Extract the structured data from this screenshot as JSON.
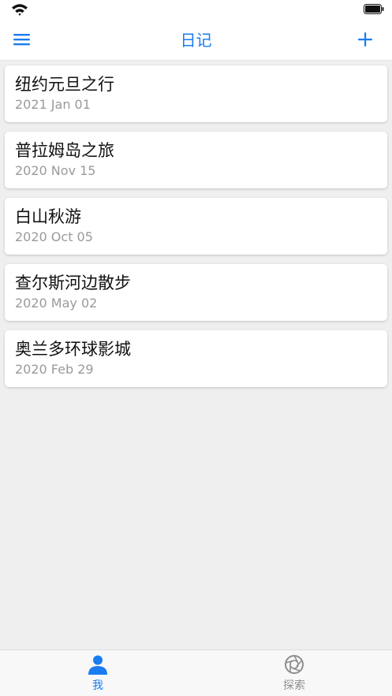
{
  "colors": {
    "accent": "#1a7cf0",
    "background": "#efefef",
    "card": "#ffffff",
    "date_text": "#9a9a9a",
    "inactive_tab": "#8e8e8e"
  },
  "status_bar": {
    "icons": [
      "wifi-icon",
      "battery-icon"
    ]
  },
  "nav": {
    "title": "日记",
    "left_icon": "menu-icon",
    "right_icon": "plus-icon"
  },
  "entries": [
    {
      "title": "纽约元旦之行",
      "date": "2021 Jan 01"
    },
    {
      "title": "普拉姆岛之旅",
      "date": "2020 Nov 15"
    },
    {
      "title": "白山秋游",
      "date": "2020 Oct 05"
    },
    {
      "title": "查尔斯河边散步",
      "date": "2020 May 02"
    },
    {
      "title": "奥兰多环球影城",
      "date": "2020 Feb 29"
    }
  ],
  "tabs": [
    {
      "label": "我",
      "icon": "person-icon",
      "active": true
    },
    {
      "label": "探索",
      "icon": "aperture-icon",
      "active": false
    }
  ]
}
